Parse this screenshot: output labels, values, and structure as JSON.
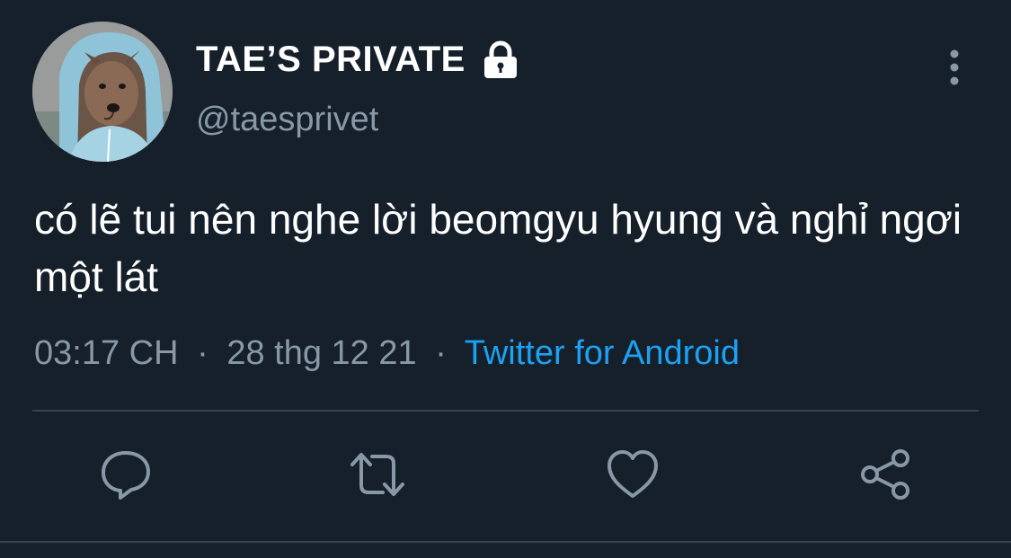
{
  "tweet": {
    "display_name": "TAE’S PRIVATE",
    "handle": "@taesprivet",
    "text": "có lẽ tui nên nghe lời beomgyu hyung và nghỉ ngơi một lát",
    "time": "03:17 CH",
    "separator": "·",
    "date": "28 thg 12 21",
    "source": "Twitter for Android"
  },
  "icons": {
    "lock": "lock-icon",
    "more": "more-vertical-icon",
    "reply": "reply-icon",
    "retweet": "retweet-icon",
    "like": "heart-icon",
    "share": "share-icon"
  },
  "colors": {
    "background": "#15202b",
    "text": "#ffffff",
    "secondary": "#8899a6",
    "link": "#1da1f2",
    "divider": "#38444d"
  }
}
